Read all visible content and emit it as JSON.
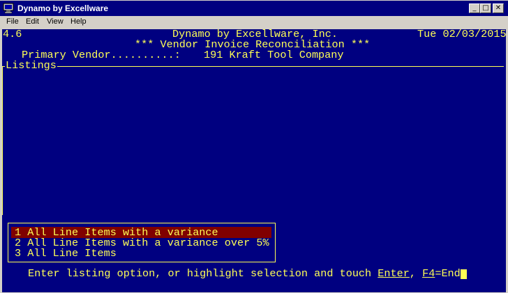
{
  "window": {
    "title": "Dynamo by Excellware",
    "minimize_glyph": "_",
    "maximize_glyph": "□",
    "close_glyph": "✕"
  },
  "menu": {
    "items": [
      {
        "label": "File"
      },
      {
        "label": "Edit"
      },
      {
        "label": "View"
      },
      {
        "label": "Help"
      }
    ]
  },
  "terminal": {
    "version": "4.6",
    "company": "Dynamo by Excellware, Inc.",
    "date": "Tue 02/03/2015",
    "screen_title": "*** Vendor Invoice Reconciliation ***",
    "vendor_label": "Primary Vendor..........:",
    "vendor_value": "191 Kraft Tool Company",
    "section_label": "Listings",
    "options": [
      {
        "label": "1 All Line Items with a variance",
        "selected": true
      },
      {
        "label": "2 All Line Items with a variance over 5%",
        "selected": false
      },
      {
        "label": "3 All Line Items",
        "selected": false
      }
    ],
    "prompt": {
      "prefix": "Enter listing option, or highlight selection and touch ",
      "enter": "Enter",
      "separator": ", ",
      "f4": "F4",
      "suffix": "=End"
    }
  },
  "colors": {
    "terminal_bg": "#000080",
    "terminal_fg": "#ffff55",
    "highlight_bg": "#800000",
    "titlebar_bg": "#000080",
    "chrome": "#d4d0c8"
  }
}
